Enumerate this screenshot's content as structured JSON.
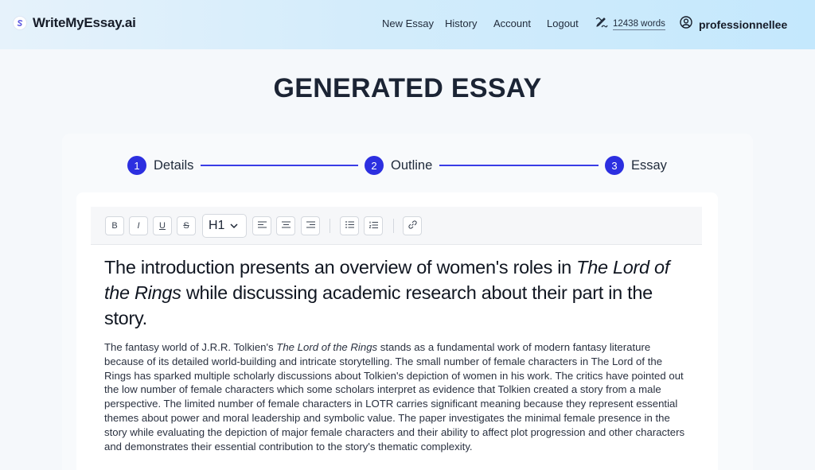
{
  "header": {
    "brand": "WriteMyEssay.ai",
    "nav": {
      "new_essay": "New Essay",
      "history": "History",
      "account": "Account",
      "logout": "Logout"
    },
    "word_count": "12438 words",
    "username": "professionnellee"
  },
  "page": {
    "title": "GENERATED ESSAY"
  },
  "stepper": {
    "steps": [
      {
        "number": "1",
        "label": "Details"
      },
      {
        "number": "2",
        "label": "Outline"
      },
      {
        "number": "3",
        "label": "Essay"
      }
    ]
  },
  "toolbar": {
    "bold": "B",
    "italic": "I",
    "underline": "U",
    "strike": "S",
    "heading_value": "H1",
    "icons": [
      "bold-icon",
      "italic-icon",
      "underline-icon",
      "strikethrough-icon",
      "chevron-down-icon",
      "align-left-icon",
      "align-center-icon",
      "align-right-icon",
      "bullet-list-icon",
      "numbered-list-icon",
      "link-icon"
    ]
  },
  "essay": {
    "heading_part1": "The introduction presents an overview of women's roles in ",
    "heading_italic": "The Lord of the Rings",
    "heading_part2": " while discussing academic research about their part in the story.",
    "para_part1": "The fantasy world of J.R.R. Tolkien's ",
    "para_italic": "The Lord of the Rings",
    "para_part2": " stands as a fundamental work of modern fantasy literature because of its detailed world-building and intricate storytelling. The small number of female characters in The Lord of the Rings has sparked multiple scholarly discussions about Tolkien's depiction of women in his work. The critics have pointed out the low number of female characters which some scholars interpret as evidence that Tolkien created a story from a male perspective. The limited number of female characters in LOTR carries significant meaning because they represent essential themes about power and moral leadership and symbolic value. The paper investigates the minimal female presence in the story while evaluating the depiction of major female characters and their ability to affect plot progression and other characters and demonstrates their essential contribution to the story's thematic complexity."
  },
  "colors": {
    "accent": "#2c2fe0",
    "header_gradient_start": "#e6f2fb",
    "header_gradient_end": "#c4e8fd",
    "page_bg": "#f5f8fb"
  }
}
